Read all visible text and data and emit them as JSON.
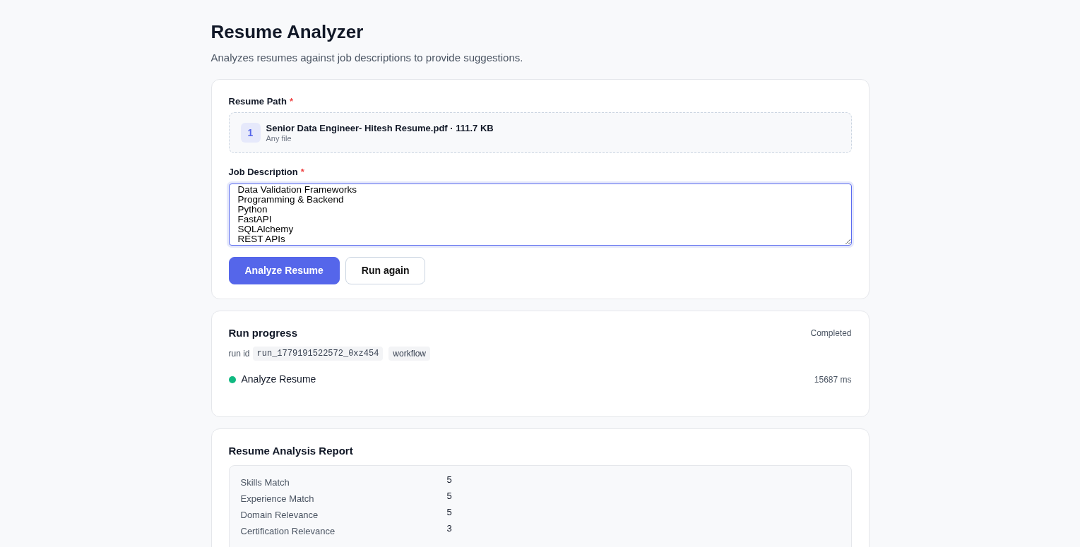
{
  "header": {
    "title": "Resume Analyzer",
    "subtitle": "Analyzes resumes against job descriptions to provide suggestions."
  },
  "form": {
    "resume_path": {
      "label": "Resume Path",
      "required": true,
      "required_mark": "*",
      "file_index": "1",
      "file_name": "Senior Data Engineer- Hitesh Resume.pdf · 111.7 KB",
      "file_hint": "Any file"
    },
    "job_description": {
      "label": "Job Description",
      "required": true,
      "required_mark": "*",
      "value": "Data Validation Frameworks\nProgramming & Backend\nPython\nFastAPI\nSQLAlchemy\nREST APIs"
    },
    "buttons": [
      {
        "label": "Analyze Resume",
        "kind": "primary"
      },
      {
        "label": "Run again",
        "kind": "secondary"
      }
    ]
  },
  "run_progress": {
    "title": "Run progress",
    "status": "Completed",
    "run_id_label": "run id",
    "run_id": "run_1779191522572_0xz454",
    "tag": "workflow",
    "steps": [
      {
        "name": "Analyze Resume",
        "duration": "15687 ms",
        "color": "#10b981"
      }
    ]
  },
  "report": {
    "title": "Resume Analysis Report",
    "rows": [
      {
        "label": "Skills Match",
        "value": "5"
      },
      {
        "label": "Experience Match",
        "value": "5"
      },
      {
        "label": "Domain Relevance",
        "value": "5"
      },
      {
        "label": "Certification Relevance",
        "value": "3"
      }
    ]
  }
}
